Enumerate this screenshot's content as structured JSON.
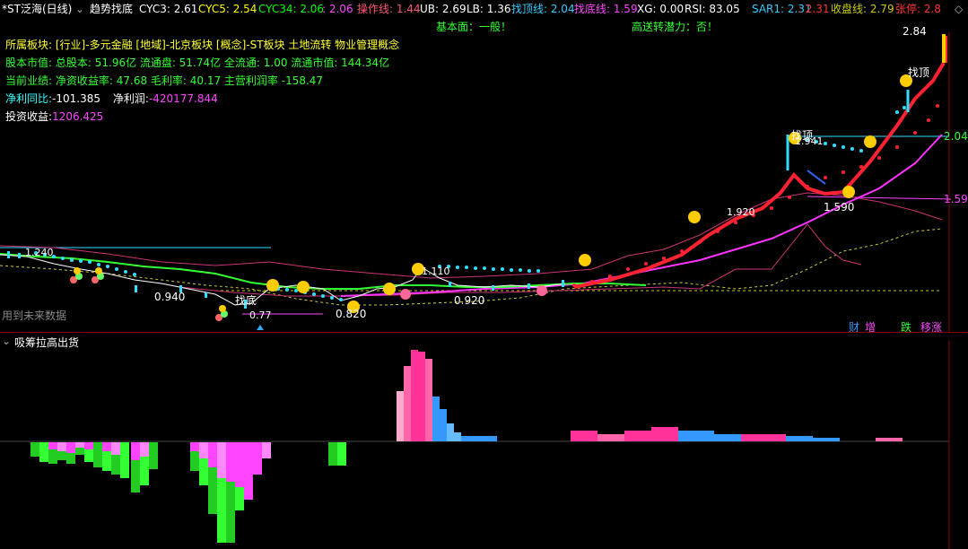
{
  "header": {
    "title": "*ST泛海(日线)",
    "indicator_name": "趋势找底",
    "items": [
      {
        "label": "CYC3: 2.61",
        "color": "#ffffff"
      },
      {
        "label": "CYC5: 2.54",
        "color": "#ffff00"
      },
      {
        "label": "CYC34: 2.06",
        "color": "#00ff00"
      },
      {
        "label": ": 2.06",
        "color": "#ff44ff"
      },
      {
        "label": "操作线: 1.44",
        "color": "#ff5577"
      },
      {
        "label": "UB: 2.69",
        "color": "#ffffff"
      },
      {
        "label": "LB: 1.36",
        "color": "#ffffff"
      },
      {
        "label": "找顶线: 2.04",
        "color": "#33ccff"
      },
      {
        "label": "找底线: 1.59",
        "color": "#ff44ff"
      },
      {
        "label": "XG: 0.00",
        "color": "#ffffff"
      },
      {
        "label": "RSI: 83.05",
        "color": "#ffffff"
      },
      {
        "label": "SAR1: 2.31",
        "color": "#33ccff"
      },
      {
        "label": ": 2.31",
        "color": "#ff3333"
      },
      {
        "label": "收盘线: 2.79",
        "color": "#cccc00"
      },
      {
        "label": "张停: 2.8",
        "color": "#ff3333"
      }
    ]
  },
  "banner": {
    "fundamental": "基本面：一般！",
    "potential": "高送转潜力：否！"
  },
  "info": {
    "sector_label": "所属板块:",
    "sector_value": "[行业]-多元金融 [地域]-北京板块 [概念]-ST板块 土地流转 物业管理概念",
    "equity_label": "股本市值:",
    "equity_value": "总股本: 51.96亿 流通盘: 51.74亿 全流通: 1.00 流通市值: 144.34亿",
    "perf_label": "当前业绩:",
    "perf_value": "净资收益率: 47.68 毛利率: 40.17 主营利润率 -158.47",
    "profit_yoy_label": "净利同比:",
    "profit_yoy_value": "-101.385",
    "net_profit_label": "净利润:",
    "net_profit_value": "-420177.844",
    "invest_label": "投资收益:",
    "invest_value": "1206.425"
  },
  "chart_labels": {
    "price_high": "2.84",
    "right_axis_1": "2.04",
    "right_axis_2": "1.59",
    "low_1590": "1.590",
    "lbl_0940": "0.940",
    "lbl_0820": "0.820",
    "lbl_0920": "0.920",
    "lbl_1110": "1.110",
    "lbl_1240": "1.240",
    "lbl_077": "0.77",
    "lbl_1941": "1.941",
    "lbl_1920": "1.920",
    "zhaodi": "找底",
    "zhaoding_1": "找顶",
    "zhaoding_2": "找顶",
    "future_data": "用到未来数据",
    "badge_cai": "财",
    "badge_zeng": "增",
    "badge_die": "跌",
    "badge_zhang": "移涨"
  },
  "sub_panel": {
    "title": "吸筹拉高出货"
  },
  "colors": {
    "red": "#ff2233",
    "cyan": "#33ddff",
    "magenta": "#ff44ff",
    "green": "#33ff33",
    "yellow": "#ffff00",
    "pink": "#ff3399",
    "blue": "#3399ff"
  }
}
